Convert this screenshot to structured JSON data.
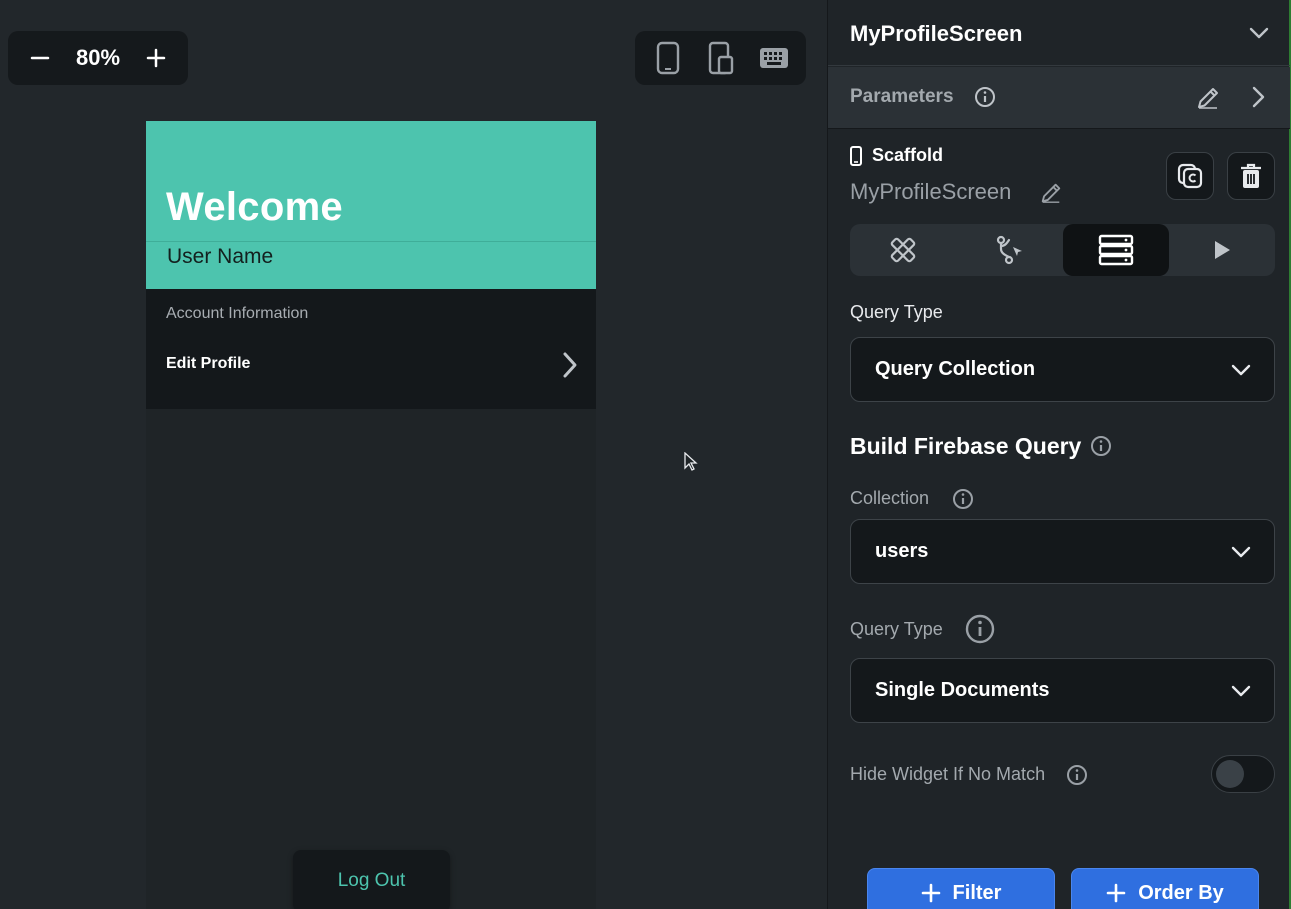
{
  "canvas": {
    "zoom_value": "80%",
    "device_buttons": [
      "phone-icon",
      "tablet-icon",
      "keyboard-icon"
    ]
  },
  "phone": {
    "header_color": "#4dc4ae",
    "welcome": "Welcome",
    "user_name": "User Name",
    "account_title": "Account Information",
    "edit_profile": "Edit Profile",
    "logout": "Log Out"
  },
  "panel": {
    "screen_title": "MyProfileScreen",
    "parameters_label": "Parameters",
    "scaffold_label": "Scaffold",
    "widget_name": "MyProfileScreen",
    "tabs": [
      "properties-icon",
      "actions-icon",
      "backend-query-icon",
      "play-icon"
    ],
    "active_tab": "backend-query-icon",
    "query_type_label": "Query Type",
    "query_type_value": "Query Collection",
    "section_title": "Build Firebase Query",
    "collection_label": "Collection",
    "collection_value": "users",
    "query_type2_label": "Query Type",
    "query_type2_value": "Single Documents",
    "hide_widget_label": "Hide Widget If No Match",
    "hide_widget_enabled": false,
    "filter_button": "Filter",
    "order_by_button": "Order By",
    "accent_blue": "#2f6fe0"
  }
}
